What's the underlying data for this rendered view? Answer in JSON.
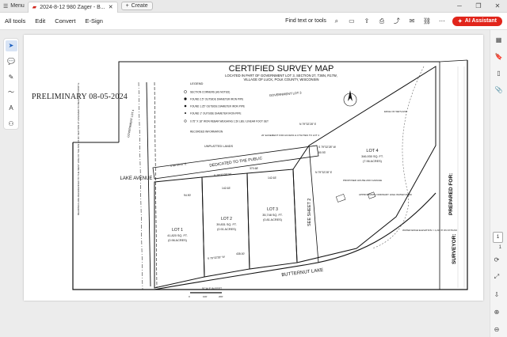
{
  "titlebar": {
    "menu_label": "Menu",
    "tab_title": "2024-8-12 980 Zager - B...",
    "create_label": "Create"
  },
  "menubar": {
    "items": [
      "All tools",
      "Edit",
      "Convert",
      "E-Sign"
    ],
    "find_label": "Find text or tools",
    "ai_label": "AI Assistant"
  },
  "page_nav": {
    "current": "1",
    "total": "1"
  },
  "map": {
    "prelim": "PRELIMINARY 08-05-2024",
    "title": "CERTIFIED SURVEY MAP",
    "subtitle_1": "LOCATED IN PART OF GOVERNMENT LOT 3, SECTION 27, T36N, R17W,",
    "subtitle_2": "VILLAGE OF LUCK, POLK COUNTY, WISCONSIN",
    "legend_title": "LEGEND",
    "legend_items": [
      "SECTION CORNERS (AS NOTED)",
      "FOUND 2.5\" OUTSIDE DIAMETER IRON PIPE",
      "FOUND 1.25\" OUTSIDE DIAMETER IRON PIPE",
      "FOUND 1\" OUTSIDE DIAMETER IRON PIPE",
      "0.75\" X 18\" IRON REBAR WEIGHING 1.50 LBS./ LINEAR FOOT SET",
      "RECORDED INFORMATION"
    ],
    "govt_lot_3": "GOVERNMENT LOT 3",
    "govt_lot_4": "GOVERNMENT LOT 4",
    "lake_avenue": "LAKE AVENUE",
    "dedicated": "DEDICATED TO THE PUBLIC",
    "unplatted": "UNPLATTED LANDS",
    "butternut_lake": "BUTTERNUT LAKE",
    "see_sheet": "SEE SHEET 2",
    "lots": [
      {
        "name": "LOT 1",
        "area_sf": "41,820 SQ. FT.",
        "area_ac": "(0.96 ACRES)"
      },
      {
        "name": "LOT 2",
        "area_sf": "39,831 SQ. FT.",
        "area_ac": "(0.91 ACRES)"
      },
      {
        "name": "LOT 3",
        "area_sf": "35,748 SQ. FT.",
        "area_ac": "(0.81 ACRES)"
      },
      {
        "name": "LOT 4",
        "area_sf": "346,930 SQ. FT.",
        "area_ac": "(7.96 ACRES)"
      }
    ],
    "bearings": {
      "b1": "N 79°32'28\" E",
      "b2": "S 79°32'28\" W",
      "b3": "S 89°50'11\" E",
      "b4": "S 79°32'28\" W",
      "b5": "S 79°32'28\" W",
      "b6": "N 79°32'28\" E"
    },
    "distances": [
      "142.63'",
      "94.90'",
      "142.63'",
      "50.93'",
      "435.00'",
      "370.68'"
    ],
    "scale_label": "SCALE IN FEET",
    "scale_values": [
      "0",
      "100'",
      "200'"
    ],
    "scale_ratio": "1\" = 100'",
    "surveyor_label": "SURVEYOR:",
    "prepared_for_label": "PREPARED FOR:",
    "notes": "BEARINGS ARE REFERENCED TO THE WEST LINE OF THE NW 1/4 OF SECTION 27 ASSUMED TO BEAR N 00°00'00\" E",
    "water_elev": "WATER EDGE ELEVATION = 1,212.8' ON 07/31/24",
    "ohwm": "APPROXIMATE ORDINARY HIGH WATER MARK",
    "edge_wetland": "EDGE OF WETLAND",
    "proposed_house": "PROPOSED HOUSE AND GARAGE",
    "easement": "20' EASEMENT FOR ACCESS & UTILITIES TO LOT 4"
  }
}
